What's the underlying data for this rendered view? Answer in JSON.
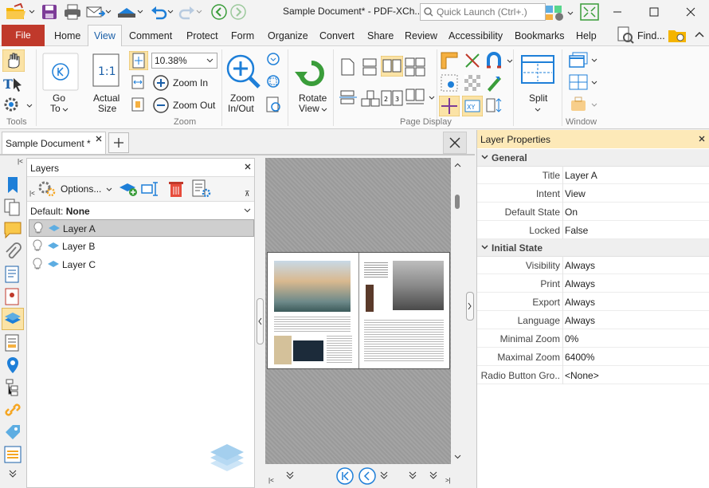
{
  "titlebar": {
    "document_title": "Sample Document* - PDF-XCh...",
    "quick_launch_placeholder": "Quick Launch (Ctrl+.)"
  },
  "menubar": {
    "file": "File",
    "tabs": [
      "Home",
      "View",
      "Comment",
      "Protect",
      "Form",
      "Organize",
      "Convert",
      "Share",
      "Review",
      "Accessibility",
      "Bookmarks",
      "Help"
    ],
    "active_tab": "View",
    "find_label": "Find..."
  },
  "ribbon": {
    "groups": {
      "tools": "Tools",
      "zoom": "Zoom",
      "page_display": "Page Display",
      "window": "Window"
    },
    "goto_label_1": "Go",
    "goto_label_2": "To",
    "actual_size_1": "Actual",
    "actual_size_2": "Size",
    "zoom_value": "10.38%",
    "zoom_in": "Zoom In",
    "zoom_out": "Zoom Out",
    "zoom_inout_1": "Zoom",
    "zoom_inout_2": "In/Out",
    "rotate_view_1": "Rotate",
    "rotate_view_2": "View",
    "split": "Split"
  },
  "doc_tab": {
    "label": "Sample Document *"
  },
  "layers_panel": {
    "title": "Layers",
    "options_label": "Options...",
    "default_prefix": "Default:",
    "default_value": "None",
    "layers": [
      {
        "name": "Layer A"
      },
      {
        "name": "Layer B"
      },
      {
        "name": "Layer C"
      }
    ],
    "selected": "Layer A"
  },
  "properties": {
    "title": "Layer Properties",
    "sections": [
      {
        "name": "General",
        "rows": [
          {
            "label": "Title",
            "value": "Layer A"
          },
          {
            "label": "Intent",
            "value": "View"
          },
          {
            "label": "Default State",
            "value": "On"
          },
          {
            "label": "Locked",
            "value": "False"
          }
        ]
      },
      {
        "name": "Initial State",
        "rows": [
          {
            "label": "Visibility",
            "value": "Always"
          },
          {
            "label": "Print",
            "value": "Always"
          },
          {
            "label": "Export",
            "value": "Always"
          },
          {
            "label": "Language",
            "value": "Always"
          },
          {
            "label": "Minimal Zoom",
            "value": "0%"
          },
          {
            "label": "Maximal Zoom",
            "value": "6400%"
          },
          {
            "label": "Radio Button Gro..",
            "value": "<None>"
          }
        ]
      }
    ]
  },
  "colors": {
    "accent": "#c0392b",
    "panel_header": "#fde9b8",
    "selection": "#cfcfcf",
    "icon_blue": "#1e7fd8"
  }
}
